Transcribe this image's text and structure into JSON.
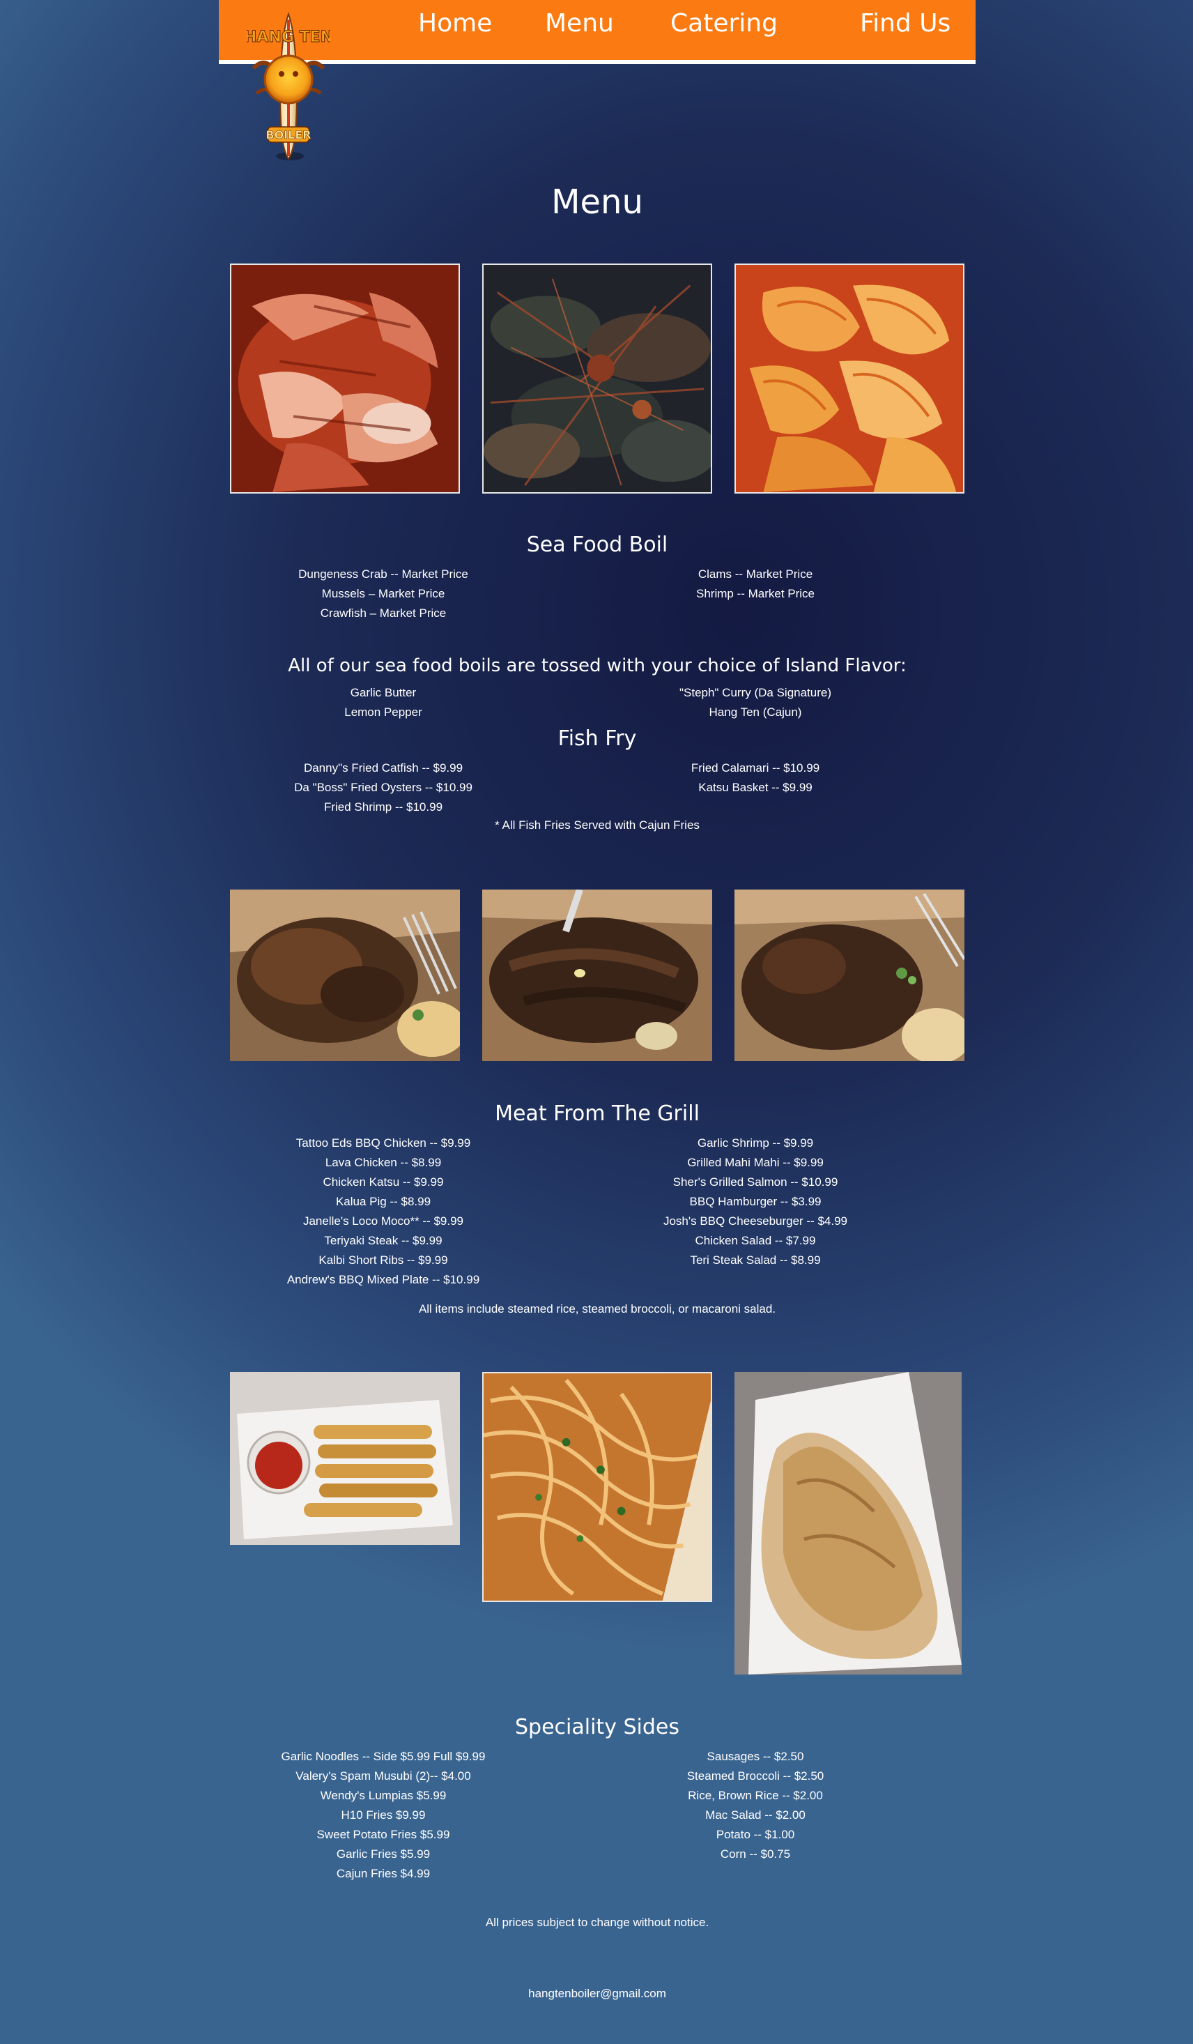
{
  "nav": {
    "home": "Home",
    "menu": "Menu",
    "catering": "Catering",
    "find_us": "Find Us"
  },
  "logo": {
    "top_text": "HANG TEN",
    "bottom_text": "BOILER"
  },
  "page_title": "Menu",
  "seafood": {
    "title": "Sea Food Boil",
    "left": [
      "Dungeness Crab -- Market Price",
      "Mussels – Market Price",
      "Crawfish – Market Price"
    ],
    "right": [
      "Clams -- Market Price",
      "Shrimp -- Market Price"
    ]
  },
  "flavor": {
    "title": "All of our sea food boils are tossed with your choice of Island Flavor:",
    "left": [
      "Garlic Butter",
      "Lemon Pepper"
    ],
    "right": [
      "\"Steph\" Curry (Da Signature)",
      "Hang Ten (Cajun)"
    ]
  },
  "fish": {
    "title": "Fish Fry",
    "left": [
      "Danny\"s Fried Catfish -- $9.99",
      "Da \"Boss\" Fried Oysters -- $10.99",
      "Fried Shrimp -- $10.99"
    ],
    "right": [
      "Fried Calamari -- $10.99",
      "Katsu Basket -- $9.99"
    ],
    "note": "* All Fish Fries Served with Cajun Fries"
  },
  "grill": {
    "title": "Meat From The Grill",
    "left": [
      "Tattoo Eds BBQ Chicken -- $9.99",
      "Lava Chicken -- $8.99",
      "Chicken Katsu -- $9.99",
      "Kalua Pig -- $8.99",
      "Janelle's Loco Moco** -- $9.99",
      "Teriyaki Steak -- $9.99",
      "Kalbi Short Ribs -- $9.99",
      "Andrew's BBQ Mixed Plate -- $10.99"
    ],
    "right": [
      "Garlic Shrimp -- $9.99",
      "Grilled Mahi Mahi -- $9.99",
      "Sher's Grilled Salmon -- $10.99",
      "BBQ Hamburger -- $3.99",
      "Josh's BBQ Cheeseburger -- $4.99",
      "Chicken Salad -- $7.99",
      "Teri Steak Salad -- $8.99"
    ],
    "note": "All items include steamed rice, steamed broccoli, or macaroni salad."
  },
  "sides": {
    "title": "Speciality Sides",
    "left": [
      "Garlic Noodles -- Side $5.99 Full $9.99",
      "Valery's Spam Musubi (2)-- $4.00",
      "Wendy's Lumpias $5.99",
      "H10 Fries $9.99",
      "Sweet Potato Fries $5.99",
      "Garlic Fries $5.99",
      "Cajun Fries $4.99"
    ],
    "right": [
      "Sausages -- $2.50",
      "Steamed Broccoli -- $2.50",
      "Rice, Brown Rice -- $2.00",
      "Mac Salad -- $2.00",
      "Potato -- $1.00",
      "Corn -- $0.75"
    ]
  },
  "footer": {
    "prices_note": "All prices subject to change without notice.",
    "email": "hangtenboiler@gmail.com"
  },
  "colors": {
    "header": "#fb7a12",
    "background": "#1d2a55",
    "text": "#ffffff"
  }
}
